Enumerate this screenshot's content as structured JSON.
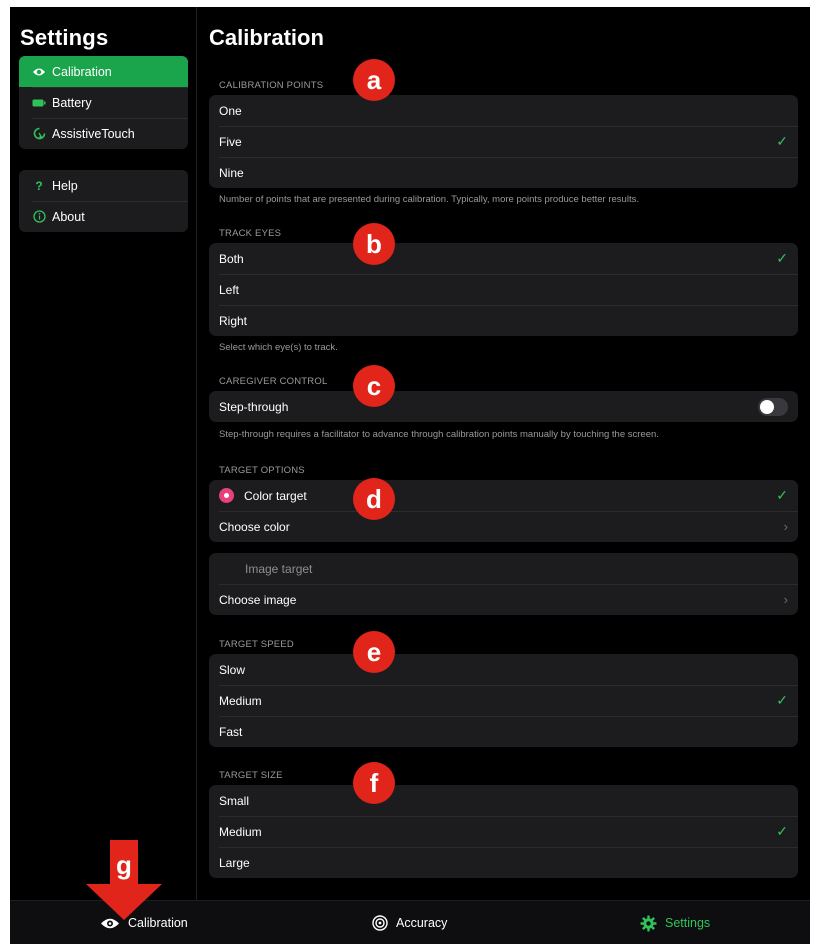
{
  "sidebar": {
    "title": "Settings",
    "group1": [
      {
        "label": "Calibration",
        "icon": "eye-icon"
      },
      {
        "label": "Battery",
        "icon": "battery-icon"
      },
      {
        "label": "AssistiveTouch",
        "icon": "assistivetouch-icon"
      }
    ],
    "group2": [
      {
        "label": "Help",
        "icon": "question-icon"
      },
      {
        "label": "About",
        "icon": "info-icon"
      }
    ]
  },
  "main": {
    "title": "Calibration",
    "calibration_points": {
      "header": "CALIBRATION POINTS",
      "options": [
        "One",
        "Five",
        "Nine"
      ],
      "selected": "Five",
      "footer": "Number of points that are presented during calibration. Typically, more points produce better results."
    },
    "track_eyes": {
      "header": "TRACK EYES",
      "options": [
        "Both",
        "Left",
        "Right"
      ],
      "selected": "Both",
      "footer": "Select which eye(s) to track."
    },
    "caregiver_control": {
      "header": "CAREGIVER CONTROL",
      "label": "Step-through",
      "enabled": false,
      "footer": "Step-through requires a facilitator to advance through calibration points manually by touching the screen."
    },
    "target_options": {
      "header": "TARGET OPTIONS",
      "color_target": "Color target",
      "choose_color": "Choose color",
      "image_target": "Image target",
      "choose_image": "Choose image",
      "color": "#e8417a"
    },
    "target_speed": {
      "header": "TARGET SPEED",
      "options": [
        "Slow",
        "Medium",
        "Fast"
      ],
      "selected": "Medium"
    },
    "target_size": {
      "header": "TARGET SIZE",
      "options": [
        "Small",
        "Medium",
        "Large"
      ],
      "selected": "Medium"
    }
  },
  "markers": {
    "a": "a",
    "b": "b",
    "c": "c",
    "d": "d",
    "e": "e",
    "f": "f",
    "g": "g"
  },
  "tabbar": {
    "tabs": [
      {
        "label": "Calibration",
        "icon": "eye-icon"
      },
      {
        "label": "Accuracy",
        "icon": "target-icon"
      },
      {
        "label": "Settings",
        "icon": "gear-icon"
      }
    ],
    "active": "Settings"
  },
  "colors": {
    "accent": "#1aa44c",
    "check": "#2fc25b",
    "marker": "#e1251b",
    "active_tab": "#2fc25b"
  }
}
